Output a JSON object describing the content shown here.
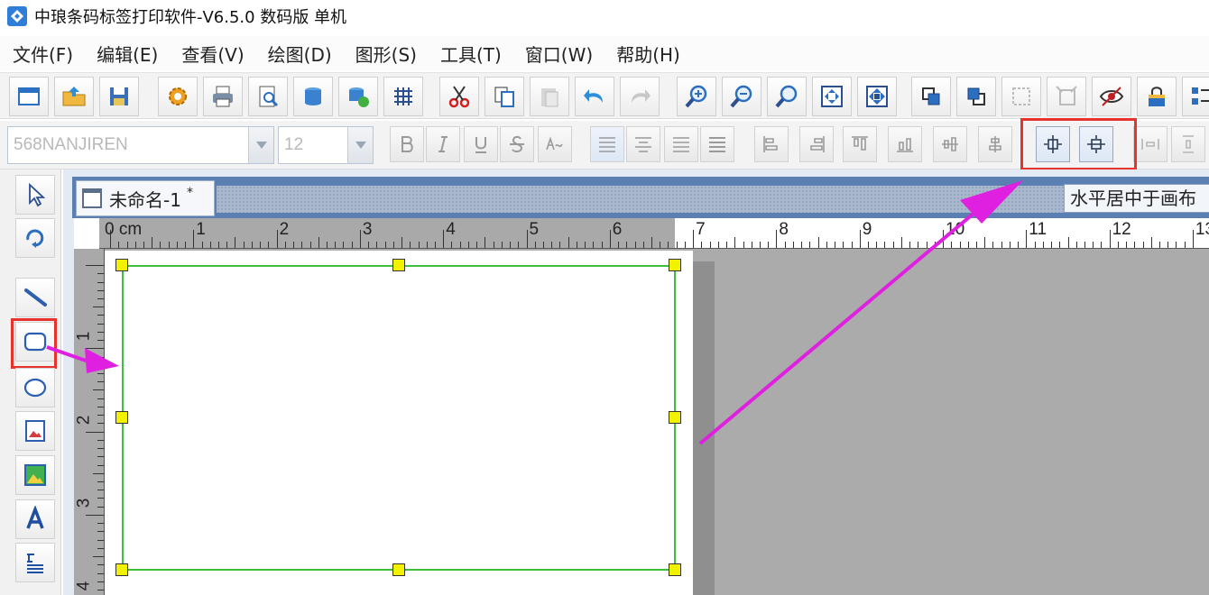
{
  "window": {
    "title": "中琅条码标签打印软件-V6.5.0 数码版 单机"
  },
  "menu": [
    {
      "label": "文件(F)"
    },
    {
      "label": "编辑(E)"
    },
    {
      "label": "查看(V)"
    },
    {
      "label": "绘图(D)"
    },
    {
      "label": "图形(S)"
    },
    {
      "label": "工具(T)"
    },
    {
      "label": "窗口(W)"
    },
    {
      "label": "帮助(H)"
    }
  ],
  "format_bar": {
    "font_name": "568NANJIREN",
    "font_size": "12"
  },
  "document": {
    "tab_title": "未命名-1",
    "modified_marker": "*"
  },
  "tooltip": {
    "text": "水平居中于画布"
  },
  "ruler": {
    "unit_label": "0 cm",
    "h_labels": [
      "1",
      "2",
      "3",
      "4",
      "5",
      "6",
      "7",
      "8",
      "9",
      "10",
      "11",
      "12",
      "13"
    ],
    "v_labels": [
      "1",
      "2",
      "3",
      "4"
    ]
  },
  "colors": {
    "accent": "#2f7fd8",
    "highlight": "#e8322c",
    "arrow": "#e020e0",
    "selection": "#3dbf3d",
    "handle": "#f2f200"
  }
}
